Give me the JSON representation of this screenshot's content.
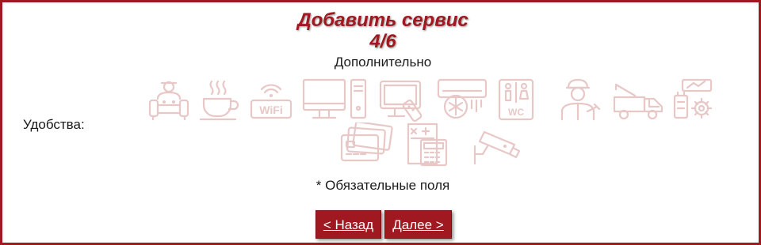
{
  "header": {
    "title": "Добавить сервис",
    "step": "4/6",
    "section": "Дополнительно"
  },
  "form": {
    "amenities_label": "Удобства:",
    "amenities": [
      {
        "icon": "sofa-waiting-icon"
      },
      {
        "icon": "coffee-cup-icon"
      },
      {
        "icon": "wifi-icon",
        "text": "WiFi"
      },
      {
        "icon": "desktop-computer-icon"
      },
      {
        "icon": "tv-remote-icon"
      },
      {
        "icon": "air-conditioner-icon"
      },
      {
        "icon": "wc-icon",
        "text": "WC"
      },
      {
        "icon": "mechanic-icon"
      },
      {
        "icon": "tow-truck-icon"
      },
      {
        "icon": "auto-parts-icon"
      },
      {
        "icon": "payment-cards-icon"
      },
      {
        "icon": "calculator-receipt-icon"
      },
      {
        "icon": "security-camera-icon"
      }
    ],
    "required_note": "* Обязательные поля"
  },
  "nav": {
    "back_label": "< Назад",
    "next_label": "Далее >"
  },
  "colors": {
    "accent": "#a01820",
    "icon_faded": "#e8c7c7"
  }
}
